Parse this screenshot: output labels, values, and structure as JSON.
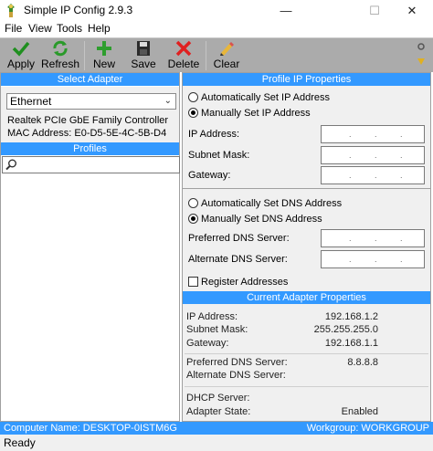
{
  "window": {
    "title": "Simple IP Config 2.9.3",
    "minimize": "—",
    "maximize": "☐",
    "close": "✕"
  },
  "menu": [
    "File",
    "View",
    "Tools",
    "Help"
  ],
  "toolbar": {
    "apply": "Apply",
    "refresh": "Refresh",
    "new": "New",
    "save": "Save",
    "delete": "Delete",
    "clear": "Clear"
  },
  "adapter": {
    "header": "Select Adapter",
    "selected": "Ethernet",
    "description": "Realtek PCIe GbE Family Controller",
    "mac": "MAC Address: E0-D5-5E-4C-5B-D4"
  },
  "profiles": {
    "header": "Profiles",
    "search_value": ""
  },
  "profile_ip": {
    "header": "Profile IP Properties",
    "auto_ip": "Automatically Set IP Address",
    "manual_ip": "Manually Set IP Address",
    "ip_label": "IP Address:",
    "subnet_label": "Subnet Mask:",
    "gateway_label": "Gateway:",
    "auto_dns": "Automatically Set DNS Address",
    "manual_dns": "Manually Set DNS Address",
    "pref_dns_label": "Preferred DNS Server:",
    "alt_dns_label": "Alternate DNS Server:",
    "register": "Register Addresses"
  },
  "current": {
    "header": "Current Adapter Properties",
    "ip_label": "IP Address:",
    "ip": "192.168.1.2",
    "subnet_label": "Subnet Mask:",
    "subnet": "255.255.255.0",
    "gateway_label": "Gateway:",
    "gateway": "192.168.1.1",
    "pref_dns_label": "Preferred DNS Server:",
    "pref_dns": "8.8.8.8",
    "alt_dns_label": "Alternate DNS Server:",
    "alt_dns": "",
    "dhcp_label": "DHCP Server:",
    "dhcp": "",
    "state_label": "Adapter State:",
    "state": "Enabled"
  },
  "status": {
    "computer": "Computer Name: DESKTOP-0ISTM6G",
    "workgroup": "Workgroup: WORKGROUP",
    "ready": "Ready"
  },
  "colors": {
    "accent": "#3399ff",
    "toolbar": "#ababab",
    "panel": "#f0f0f0"
  },
  "icons": [
    "app-icon",
    "apply-check-icon",
    "refresh-icon",
    "new-plus-icon",
    "save-disk-icon",
    "delete-x-icon",
    "clear-pencil-icon",
    "search-icon"
  ]
}
